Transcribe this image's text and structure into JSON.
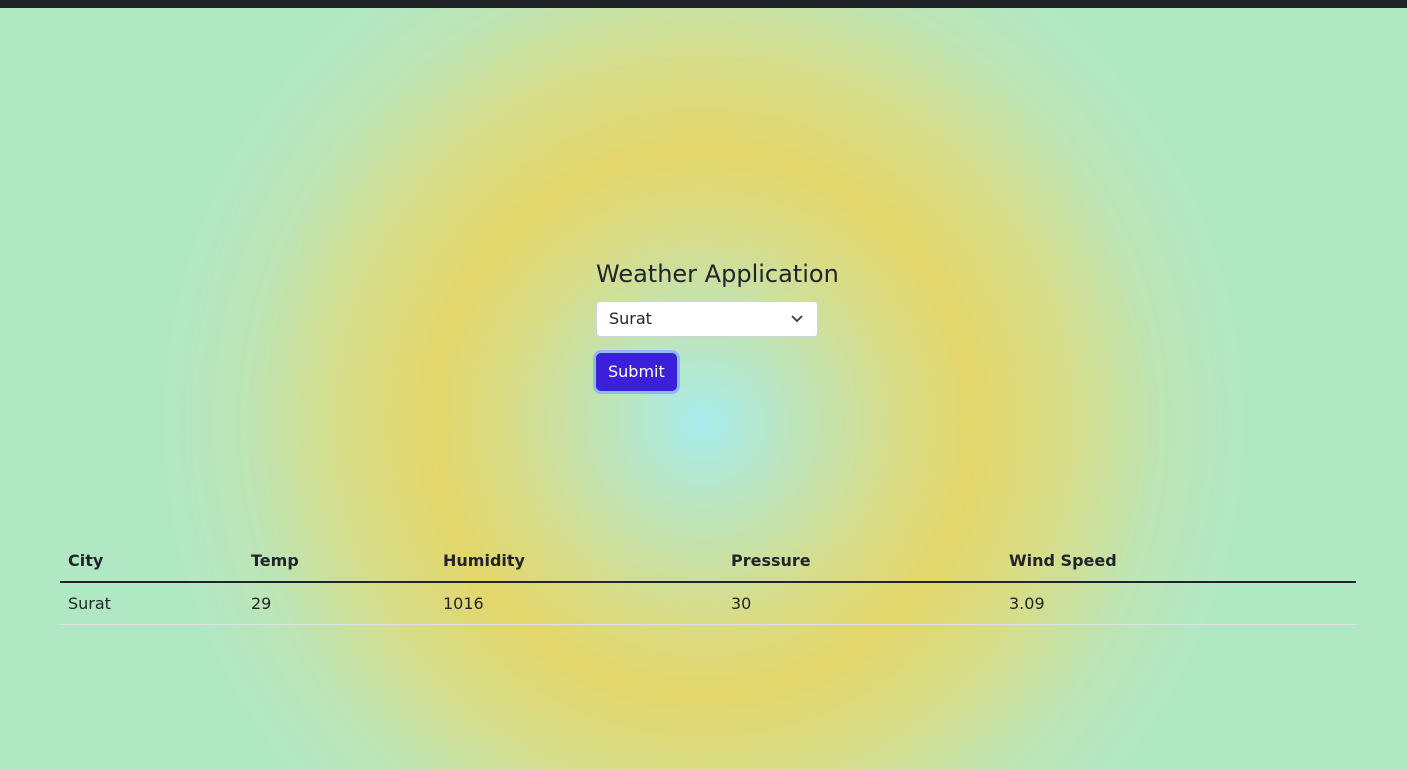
{
  "page": {
    "title": "Weather Application"
  },
  "form": {
    "selected_city": "Surat",
    "submit_label": "Submit"
  },
  "table": {
    "headers": [
      "City",
      "Temp",
      "Humidity",
      "Pressure",
      "Wind Speed"
    ],
    "rows": [
      [
        "Surat",
        "29",
        "1016",
        "30",
        "3.09"
      ]
    ]
  },
  "colors": {
    "button": "#3c1fd8",
    "topbar": "#202327"
  }
}
